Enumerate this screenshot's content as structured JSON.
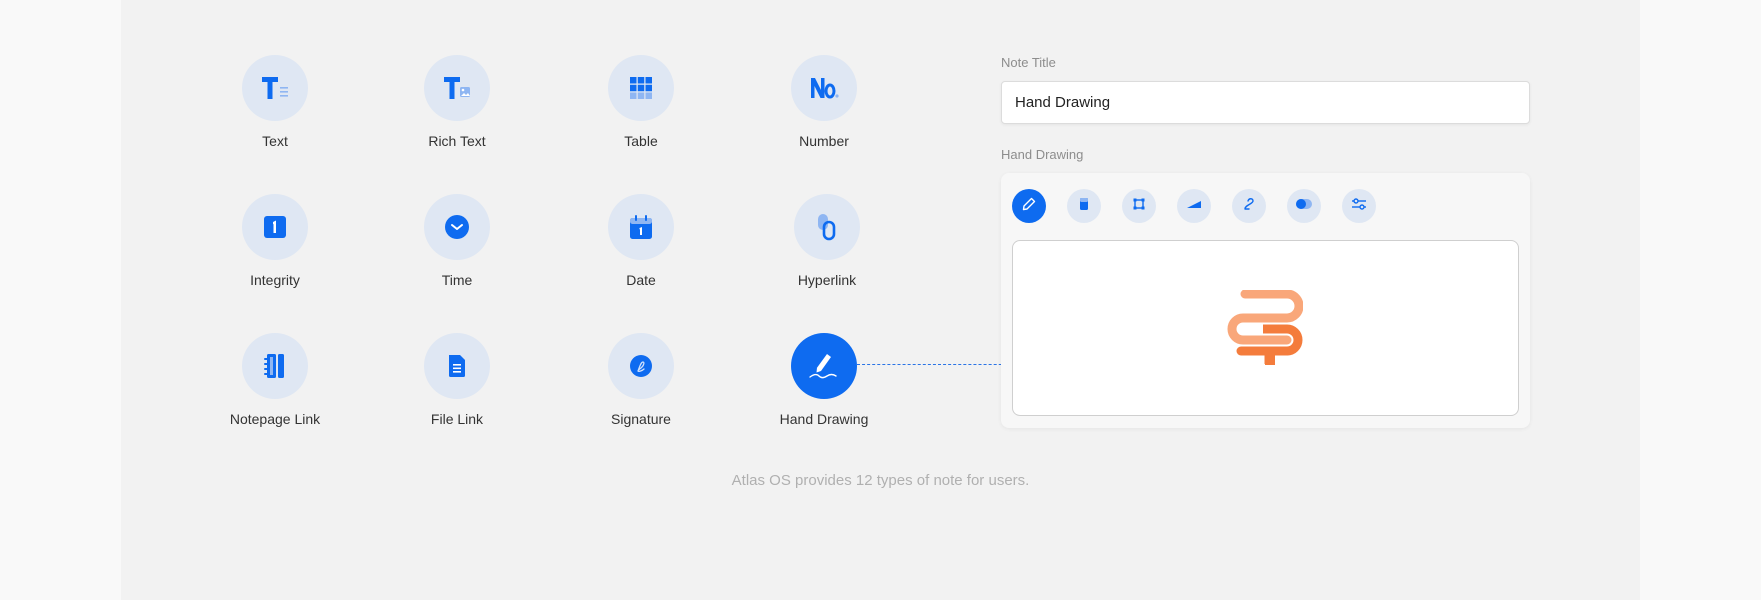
{
  "note_types": [
    {
      "label": "Text",
      "icon": "text-icon"
    },
    {
      "label": "Rich Text",
      "icon": "rich-text-icon"
    },
    {
      "label": "Table",
      "icon": "table-icon"
    },
    {
      "label": "Number",
      "icon": "number-icon"
    },
    {
      "label": "Integrity",
      "icon": "integer-icon"
    },
    {
      "label": "Time",
      "icon": "clock-icon"
    },
    {
      "label": "Date",
      "icon": "calendar-icon"
    },
    {
      "label": "Hyperlink",
      "icon": "link-icon"
    },
    {
      "label": "Notepage Link",
      "icon": "notebook-icon"
    },
    {
      "label": "File Link",
      "icon": "file-icon"
    },
    {
      "label": "Signature",
      "icon": "signature-icon"
    },
    {
      "label": "Hand Drawing",
      "icon": "pen-drawing-icon",
      "selected": true
    }
  ],
  "form": {
    "title_label": "Note Title",
    "title_value": "Hand Drawing",
    "drawing_label": "Hand Drawing"
  },
  "toolbar": [
    {
      "icon": "pencil-icon",
      "active": true
    },
    {
      "icon": "eraser-icon"
    },
    {
      "icon": "crop-icon"
    },
    {
      "icon": "stroke-width-icon"
    },
    {
      "icon": "curve-icon"
    },
    {
      "icon": "toggle-icon"
    },
    {
      "icon": "sliders-icon"
    }
  ],
  "footer": {
    "caption": "Atlas OS provides 12 types of note for users."
  },
  "colors": {
    "accent": "#0e6bf0",
    "icon_bg": "#dfe7f3",
    "drawing_light": "#f9a77a",
    "drawing_dark": "#f47c3c"
  }
}
